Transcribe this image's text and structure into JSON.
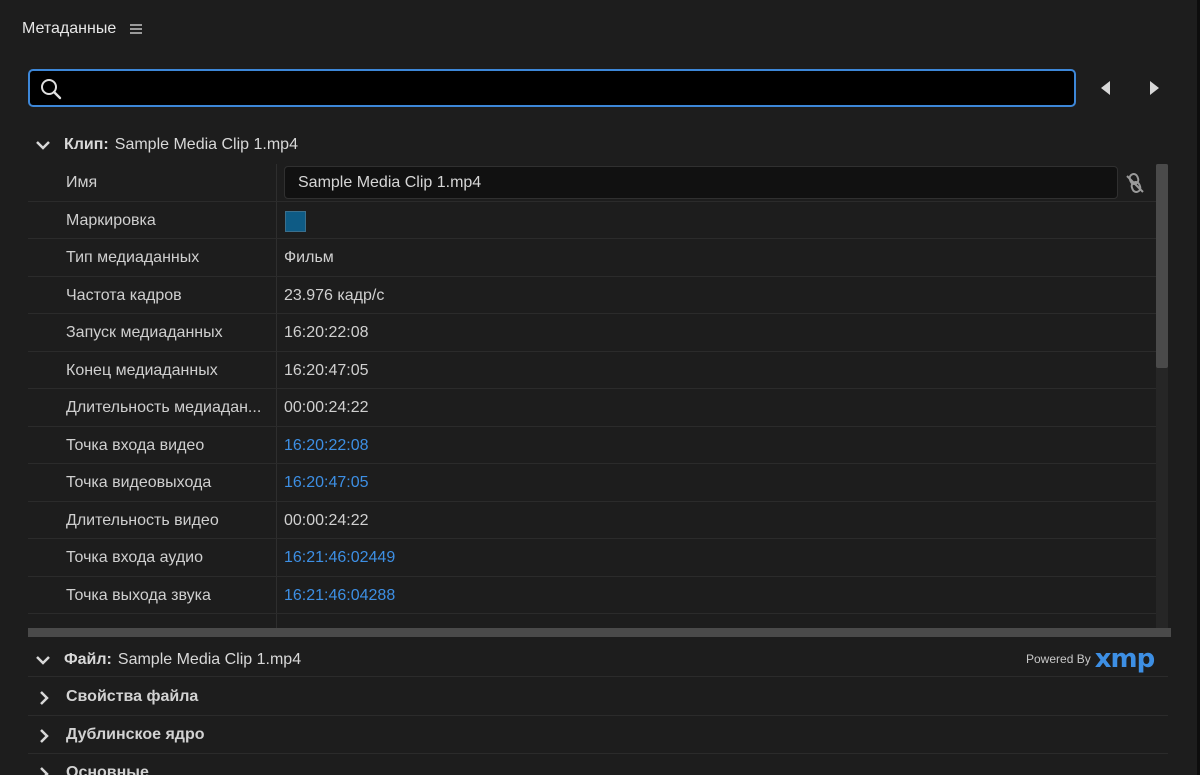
{
  "header": {
    "title": "Метаданные",
    "menu_icon": "hamburger-menu-icon"
  },
  "search": {
    "value": "",
    "placeholder": ""
  },
  "clip_section": {
    "key": "Клип:",
    "value": "Sample Media Clip 1.mp4",
    "rows": [
      {
        "label": "Имя",
        "value": "Sample Media Clip 1.mp4"
      },
      {
        "label": "Маркировка",
        "value": "",
        "swatch_color": "#0e5b85"
      },
      {
        "label": "Тип медиаданных",
        "value": "Фильм"
      },
      {
        "label": "Частота кадров",
        "value": "23.976 кадр/с"
      },
      {
        "label": "Запуск медиаданных",
        "value": "16:20:22:08"
      },
      {
        "label": "Конец медиаданных",
        "value": "16:20:47:05"
      },
      {
        "label": "Длительность медиадан...",
        "value": "00:00:24:22"
      },
      {
        "label": "Точка входа видео",
        "value": "16:20:22:08"
      },
      {
        "label": "Точка видеовыхода",
        "value": "16:20:47:05"
      },
      {
        "label": "Длительность видео",
        "value": "00:00:24:22"
      },
      {
        "label": "Точка входа аудио",
        "value": "16:21:46:02449"
      },
      {
        "label": "Точка выхода звука",
        "value": "16:21:46:04288"
      }
    ]
  },
  "file_section": {
    "key": "Файл:",
    "value": "Sample Media Clip 1.mp4",
    "powered_by": "Powered By",
    "xmp_logo": "xmp",
    "subsections": [
      {
        "label": "Свойства файла"
      },
      {
        "label": "Дублинское ядро"
      },
      {
        "label": "Основные"
      }
    ]
  },
  "colors": {
    "accent": "#3d87d8",
    "link": "#3d8fe4",
    "background": "#1d1d1d"
  }
}
